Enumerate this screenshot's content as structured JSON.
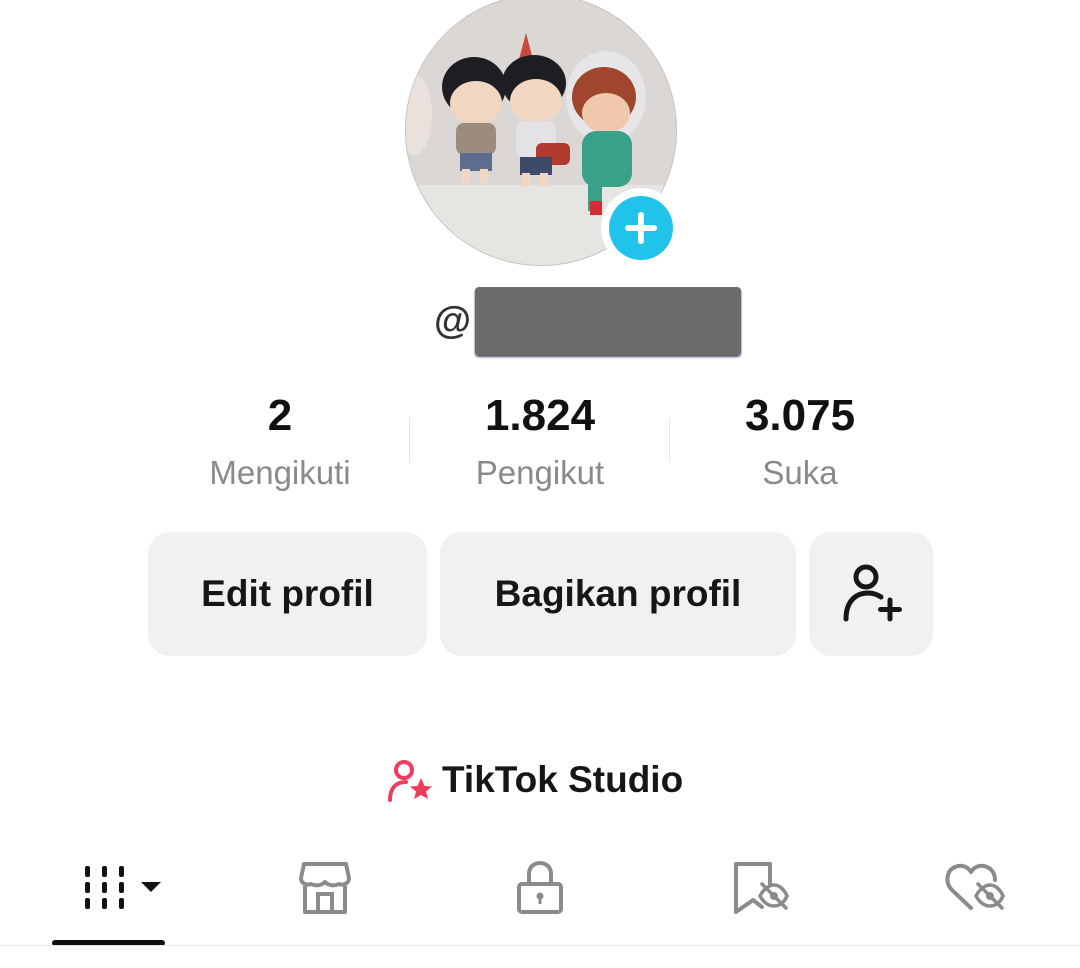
{
  "profile": {
    "username_prefix": "@",
    "add_avatar_icon": "plus-icon",
    "accent_color": "#20c4ea"
  },
  "stats": [
    {
      "value": "2",
      "label": "Mengikuti"
    },
    {
      "value": "1.824",
      "label": "Pengikut"
    },
    {
      "value": "3.075",
      "label": "Suka"
    }
  ],
  "actions": {
    "edit_label": "Edit profil",
    "share_label": "Bagikan profil",
    "add_friend_icon": "person-plus-icon"
  },
  "studio": {
    "label": "TikTok Studio",
    "icon": "person-star-icon",
    "icon_color": "#ee3d5c"
  },
  "tabs": [
    {
      "icon": "grid-icon",
      "selected": true
    },
    {
      "icon": "shop-icon",
      "selected": false
    },
    {
      "icon": "lock-icon",
      "selected": false
    },
    {
      "icon": "bookmark-hidden-icon",
      "selected": false
    },
    {
      "icon": "heart-hidden-icon",
      "selected": false
    }
  ]
}
